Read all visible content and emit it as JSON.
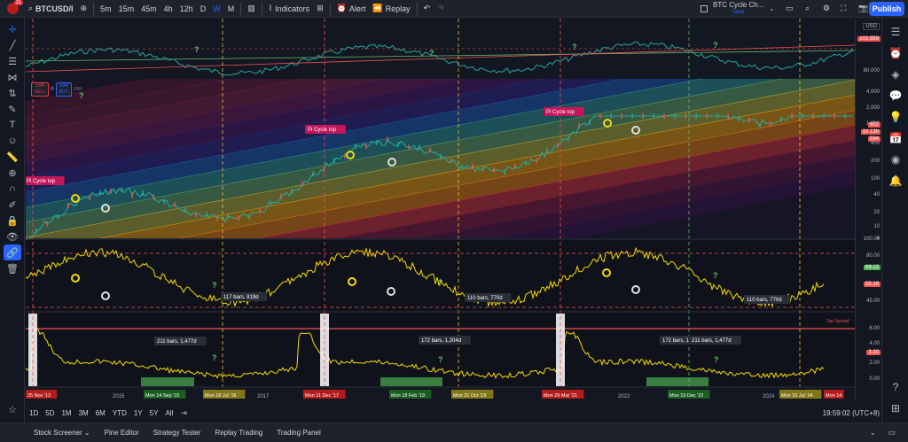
{
  "topbar": {
    "avatar_badge": "11",
    "symbol": "BTCUSD/I",
    "intervals": [
      "5m",
      "15m",
      "45m",
      "4h",
      "12h",
      "D",
      "W",
      "M"
    ],
    "active_interval": "W",
    "indicators_label": "Indicators",
    "alert_label": "Alert",
    "replay_label": "Replay",
    "layout_name": "BTC Cycle Ch...",
    "layout_status": "Save",
    "publish_label": "Publish"
  },
  "trade": {
    "sell_price": "594",
    "sell_label": "SELL",
    "spread": "0",
    "buy_price": "594",
    "buy_label": "BUY",
    "qty_label": "DRY"
  },
  "panes": {
    "main_annotations": [
      "Pi Cycle top",
      "Pi Cycle top",
      "Pi Cycle top"
    ],
    "osc1_bars": [
      "117 bars, 819d",
      "110 bars, 770d",
      "110 bars, 770d"
    ],
    "osc2_bars": [
      "211 bars, 1,477d",
      "172 bars, 1,204d",
      "172 bars, 1,477d",
      "211 bars, 1,477d"
    ],
    "osc2_flag": "Top Spread"
  },
  "price_axis": {
    "currency": "USD",
    "top_labels": [
      "102,959",
      "80,000"
    ],
    "log_labels": [
      "4,000",
      "2,000",
      "1,000",
      "400",
      "200",
      "100",
      "40",
      "20",
      "10",
      "4",
      "1"
    ],
    "price_tag": "602",
    "countdown": "2d 13h",
    "price_tag2": "594",
    "osc1_labels": [
      "100.00",
      "80.00",
      "69.12",
      "55.19",
      "45.00"
    ],
    "osc2_labels": [
      "6.00",
      "4.00",
      "3.20",
      "2.00",
      "0.00"
    ]
  },
  "time_axis": {
    "year_labels": [
      "2015",
      "2017",
      "2022",
      "2024"
    ],
    "date_tags": [
      {
        "text": "25 Nov '13",
        "color": "#b71c1c"
      },
      {
        "text": "Mon 14 Sep '15",
        "color": "#1b5e20"
      },
      {
        "text": "Mon 18 Jul '16",
        "color": "#827717"
      },
      {
        "text": "Mon 11 Dec '17",
        "color": "#b71c1c"
      },
      {
        "text": "Mon 18 Feb '19",
        "color": "#1b5e20"
      },
      {
        "text": "Mon 21 Oct '19",
        "color": "#827717"
      },
      {
        "text": "Mon 29 Mar '21",
        "color": "#b71c1c"
      },
      {
        "text": "Mon 19 Dec '22",
        "color": "#1b5e20"
      },
      {
        "text": "Mon 15 Jul '24",
        "color": "#827717"
      },
      {
        "text": "Mon 14",
        "color": "#b71c1c"
      }
    ]
  },
  "range_buttons": [
    "1D",
    "5D",
    "1M",
    "3M",
    "6M",
    "YTD",
    "1Y",
    "5Y",
    "All"
  ],
  "clock": "19:59:02 (UTC+8)",
  "footer_tabs": [
    "Stock Screener",
    "Pine Editor",
    "Strategy Tester",
    "Replay Trading",
    "Trading Panel"
  ],
  "colors": {
    "accent": "#2962ff",
    "sell": "#f23645",
    "buy": "#2962ff",
    "osc_line": "#f5d90a",
    "bg": "#131722"
  }
}
